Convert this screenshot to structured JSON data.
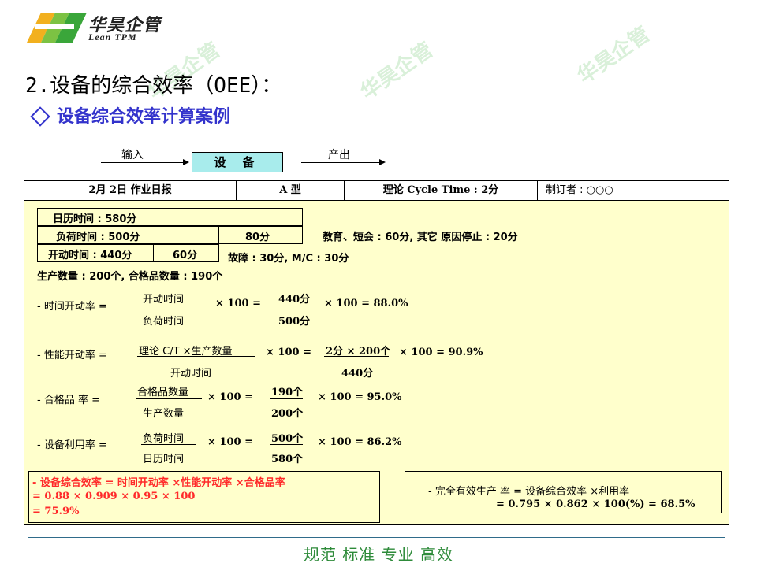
{
  "header": {
    "logo_cn": "华昊企管",
    "logo_en": "Lean TPM",
    "section_title": "2.设备的综合效率（OEE）：",
    "subtitle": "设备综合效率计算案例"
  },
  "flow": {
    "input_label": "输入",
    "equipment_label": "设 备",
    "output_label": "产出"
  },
  "table_header": {
    "date": "2月 2日 作业日报",
    "model": "A 型",
    "cycle_time": "理论 Cycle Time : 2分",
    "author": "制订者 : ○○○"
  },
  "times": {
    "calendar_time": "日历时间 : 580分",
    "load_time": "负荷时间 : 500分",
    "load_loss": "80分",
    "load_loss_note": "教育、短会 : 60分,  其它 原因停止 : 20分",
    "operating_time": "开动时间 : 440分",
    "operating_loss": "60分",
    "operating_loss_note": "故障 : 30分, M/C : 30分",
    "production_qty": "生产数量 : 200个, 合格品数量 : 190个"
  },
  "formulas": {
    "availability": {
      "label": "- 时间开动率  =",
      "numerator": "开动时间",
      "denominator": "负荷时间",
      "times100": "× 100   =",
      "value_num": "440分",
      "value_den": "500分",
      "result": "× 100  =  88.0%"
    },
    "performance": {
      "label": "- 性能开动率  =",
      "numerator": "理论 C/T ×生产数量",
      "denominator": "开动时间",
      "times100": "× 100   =",
      "value_num": "2分 × 200个",
      "value_den": "440分",
      "result": "× 100  =  90.9%"
    },
    "quality": {
      "label": "- 合格品    率  =",
      "numerator": "合格品数量",
      "denominator": "生产数量",
      "times100": "× 100   =",
      "value_num": "190个",
      "value_den": "200个",
      "result": "× 100  =  95.0%"
    },
    "utilization": {
      "label": "- 设备利用率  =",
      "numerator": "负荷时间",
      "denominator": "日历时间",
      "times100": "× 100   =",
      "value_num": "500个",
      "value_den": "580个",
      "result": "× 100  =  86.2%"
    }
  },
  "oee_box": {
    "line1": "- 设备综合效率  =  时间开动率 ×性能开动率 ×合格品率",
    "line2": "= 0.88  × 0.909  × 0.95   × 100",
    "line3": "=  75.9%"
  },
  "teep_box": {
    "line1": "- 完全有效生产 率 =  设备综合效率 ×利用率",
    "line2": "= 0.795   × 0.862   ×   100(%)    = 68.5%"
  },
  "footer": {
    "slogan": "规范 标准 专业 高效"
  },
  "watermark": "华昊企管",
  "colors": {
    "title_blue": "#3333cc",
    "table_bg": "#ffffcc",
    "equipment_bg": "#a8ecec",
    "red_text": "#ff2a2a",
    "footer_green": "#2e8b3a"
  }
}
